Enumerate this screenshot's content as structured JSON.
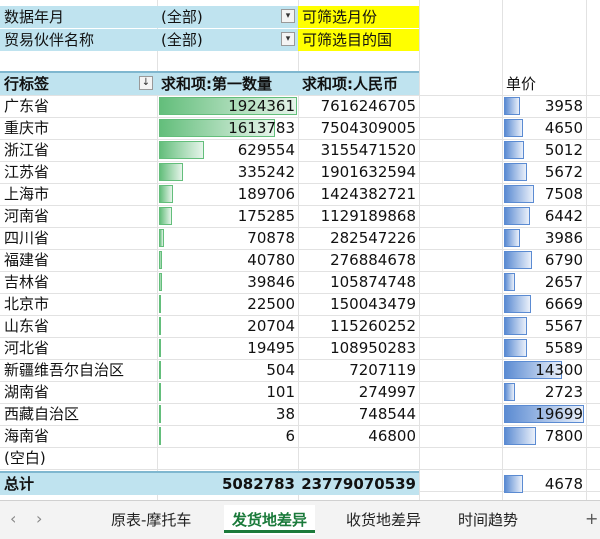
{
  "filters": [
    {
      "label": "数据年月",
      "value": "(全部)",
      "note": "可筛选月份"
    },
    {
      "label": "贸易伙伴名称",
      "value": "(全部)",
      "note": "可筛选目的国"
    }
  ],
  "headers": {
    "row_label": "行标签",
    "sort_icon": "↓",
    "qty": "求和项:第一数量",
    "rmb": "求和项:人民币",
    "price": "单价"
  },
  "rows": [
    {
      "name": "广东省",
      "qty": "1924361",
      "rmb": "7616246705",
      "price": "3958",
      "qty_v": 1924361,
      "price_v": 3958
    },
    {
      "name": "重庆市",
      "qty": "1613783",
      "rmb": "7504309005",
      "price": "4650",
      "qty_v": 1613783,
      "price_v": 4650
    },
    {
      "name": "浙江省",
      "qty": "629554",
      "rmb": "3155471520",
      "price": "5012",
      "qty_v": 629554,
      "price_v": 5012
    },
    {
      "name": "江苏省",
      "qty": "335242",
      "rmb": "1901632594",
      "price": "5672",
      "qty_v": 335242,
      "price_v": 5672
    },
    {
      "name": "上海市",
      "qty": "189706",
      "rmb": "1424382721",
      "price": "7508",
      "qty_v": 189706,
      "price_v": 7508
    },
    {
      "name": "河南省",
      "qty": "175285",
      "rmb": "1129189868",
      "price": "6442",
      "qty_v": 175285,
      "price_v": 6442
    },
    {
      "name": "四川省",
      "qty": "70878",
      "rmb": "282547226",
      "price": "3986",
      "qty_v": 70878,
      "price_v": 3986
    },
    {
      "name": "福建省",
      "qty": "40780",
      "rmb": "276884678",
      "price": "6790",
      "qty_v": 40780,
      "price_v": 6790
    },
    {
      "name": "吉林省",
      "qty": "39846",
      "rmb": "105874748",
      "price": "2657",
      "qty_v": 39846,
      "price_v": 2657
    },
    {
      "name": "北京市",
      "qty": "22500",
      "rmb": "150043479",
      "price": "6669",
      "qty_v": 22500,
      "price_v": 6669
    },
    {
      "name": "山东省",
      "qty": "20704",
      "rmb": "115260252",
      "price": "5567",
      "qty_v": 20704,
      "price_v": 5567
    },
    {
      "name": "河北省",
      "qty": "19495",
      "rmb": "108950283",
      "price": "5589",
      "qty_v": 19495,
      "price_v": 5589
    },
    {
      "name": "新疆维吾尔自治区",
      "qty": "504",
      "rmb": "7207119",
      "price": "14300",
      "qty_v": 504,
      "price_v": 14300
    },
    {
      "name": "湖南省",
      "qty": "101",
      "rmb": "274997",
      "price": "2723",
      "qty_v": 101,
      "price_v": 2723
    },
    {
      "name": "西藏自治区",
      "qty": "38",
      "rmb": "748544",
      "price": "19699",
      "qty_v": 38,
      "price_v": 19699
    },
    {
      "name": "海南省",
      "qty": "6",
      "rmb": "46800",
      "price": "7800",
      "qty_v": 6,
      "price_v": 7800
    },
    {
      "name": "(空白)",
      "qty": "",
      "rmb": "",
      "price": "",
      "qty_v": 0,
      "price_v": 0
    }
  ],
  "total": {
    "name": "总计",
    "qty": "5082783",
    "rmb": "23779070539",
    "price": "4678",
    "price_v": 4678
  },
  "tabs": [
    "原表-摩托车",
    "发货地差异",
    "收货地差异",
    "时间趋势"
  ],
  "active_tab": 1,
  "nav": {
    "prev": "‹",
    "next": "›",
    "add": "+"
  },
  "colors": {
    "header_fill": "#bfe3ef",
    "note_fill": "#ffff00",
    "qty_bar": "#63be7b",
    "price_bar": "#5b8bd2",
    "active_tab": "#1a7a3a"
  }
}
